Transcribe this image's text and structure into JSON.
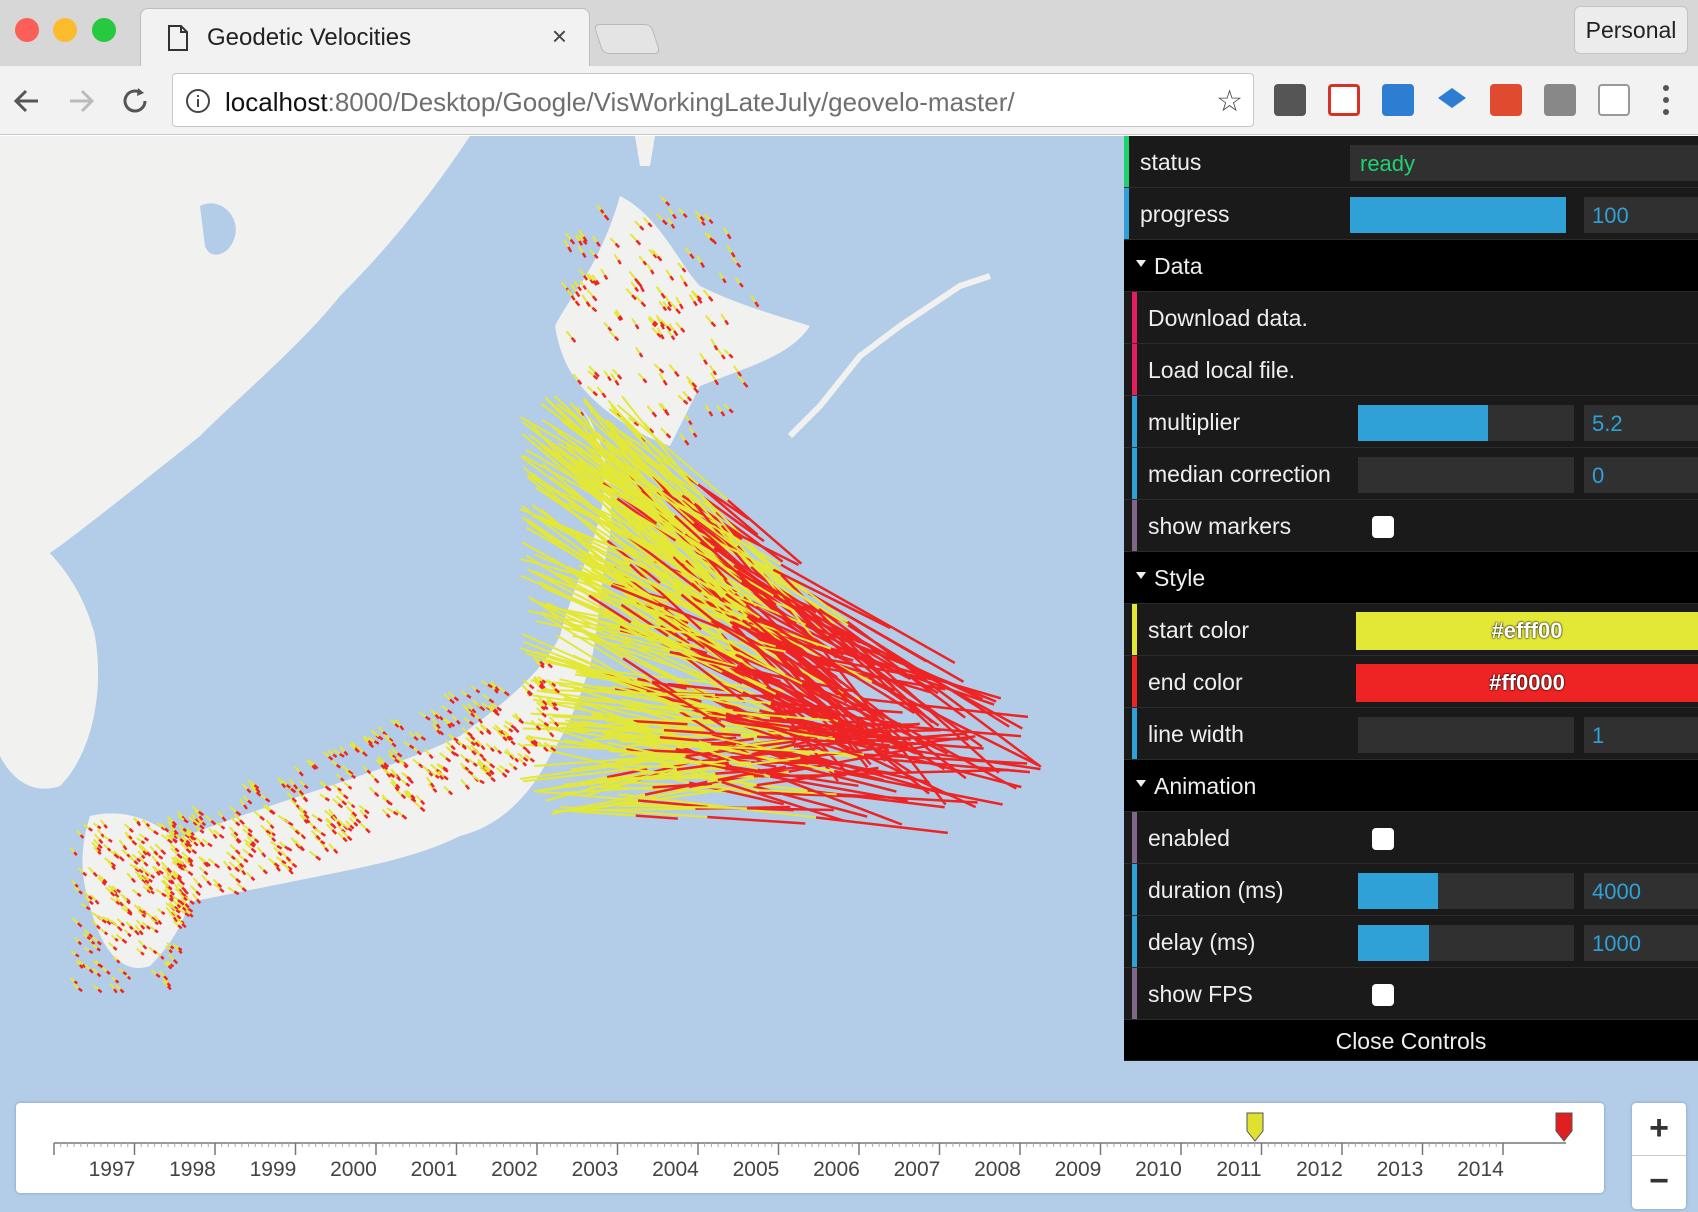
{
  "browser": {
    "tab_title": "Geodetic Velocities",
    "tab_close": "×",
    "profile": "Personal",
    "url_host": "localhost",
    "url_rest": ":8000/Desktop/Google/VisWorkingLateJuly/geovelo-master/"
  },
  "controls": {
    "status": {
      "label": "status",
      "value": "ready"
    },
    "progress": {
      "label": "progress",
      "value": "100",
      "fraction": 1.0
    },
    "data_folder": "Data",
    "download": "Download data.",
    "load_local": "Load local file.",
    "multiplier": {
      "label": "multiplier",
      "value": "5.2",
      "fraction": 0.6
    },
    "median_correction": {
      "label": "median correction",
      "value": "0",
      "fraction": 0
    },
    "show_markers": {
      "label": "show markers",
      "checked": false
    },
    "style_folder": "Style",
    "start_color": {
      "label": "start color",
      "value": "#efff00",
      "color": "#e3e836"
    },
    "end_color": {
      "label": "end color",
      "value": "#ff0000",
      "color": "#ee2424"
    },
    "line_width": {
      "label": "line width",
      "value": "1",
      "fraction": 0
    },
    "animation_folder": "Animation",
    "enabled": {
      "label": "enabled",
      "checked": false
    },
    "duration": {
      "label": "duration (ms)",
      "value": "4000",
      "fraction": 0.37
    },
    "delay": {
      "label": "delay (ms)",
      "value": "1000",
      "fraction": 0.33
    },
    "show_fps": {
      "label": "show FPS",
      "checked": false
    },
    "close": "Close Controls"
  },
  "timeline": {
    "years": [
      "1997",
      "1998",
      "1999",
      "2000",
      "2001",
      "2002",
      "2003",
      "2004",
      "2005",
      "2006",
      "2007",
      "2008",
      "2009",
      "2010",
      "2011",
      "2012",
      "2013",
      "2014"
    ],
    "start_marker_color": "#e0e030",
    "end_marker_color": "#e02020"
  },
  "zoom": {
    "in": "+",
    "out": "−"
  }
}
